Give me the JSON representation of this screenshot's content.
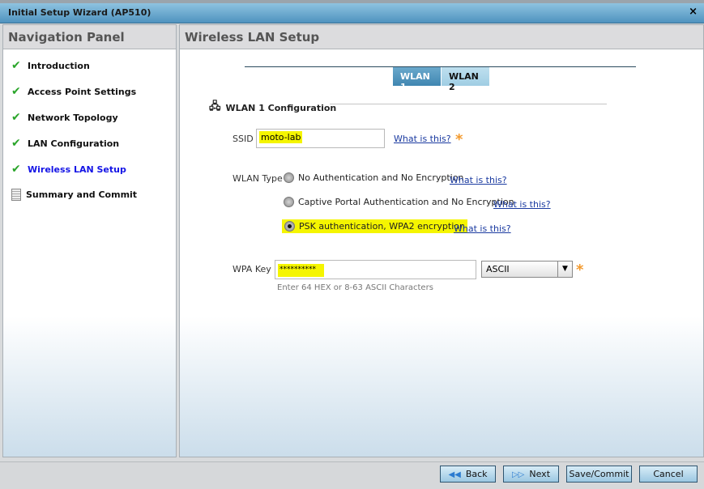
{
  "window": {
    "title": "Initial Setup Wizard (AP510)",
    "close": "×"
  },
  "nav": {
    "title": "Navigation Panel",
    "items": [
      {
        "label": "Introduction",
        "icon": "check-icon",
        "active": false
      },
      {
        "label": "Access Point Settings",
        "icon": "check-icon",
        "active": false
      },
      {
        "label": "Network Topology",
        "icon": "check-icon",
        "active": false
      },
      {
        "label": "LAN Configuration",
        "icon": "check-icon",
        "active": false
      },
      {
        "label": "Wireless LAN Setup",
        "icon": "check-icon",
        "active": true
      },
      {
        "label": "Summary and Commit",
        "icon": "document-icon",
        "active": false
      }
    ]
  },
  "main": {
    "title": "Wireless LAN Setup",
    "tabs": [
      {
        "label": "WLAN 1",
        "selected": true
      },
      {
        "label": "WLAN 2",
        "selected": false
      }
    ],
    "section": "WLAN 1 Configuration",
    "ssid": {
      "label": "SSID",
      "value": "moto-lab",
      "help": "What is this?"
    },
    "wlan_type": {
      "label": "WLAN Type",
      "options": [
        {
          "label": "No Authentication and No Encryption",
          "help": "What is this?",
          "selected": false
        },
        {
          "label": "Captive Portal Authentication and No Encryption",
          "help": "What is this?",
          "selected": false
        },
        {
          "label": "PSK authentication, WPA2 encryption",
          "help": "What is this?",
          "selected": true
        }
      ]
    },
    "wpa_key": {
      "label": "WPA Key",
      "value": "**********",
      "format": "ASCII",
      "hint": "Enter 64 HEX or 8-63 ASCII Characters"
    },
    "required_color": "#f39a2e"
  },
  "buttons": {
    "back": "Back",
    "next": "Next",
    "save": "Save/Commit",
    "cancel": "Cancel"
  }
}
